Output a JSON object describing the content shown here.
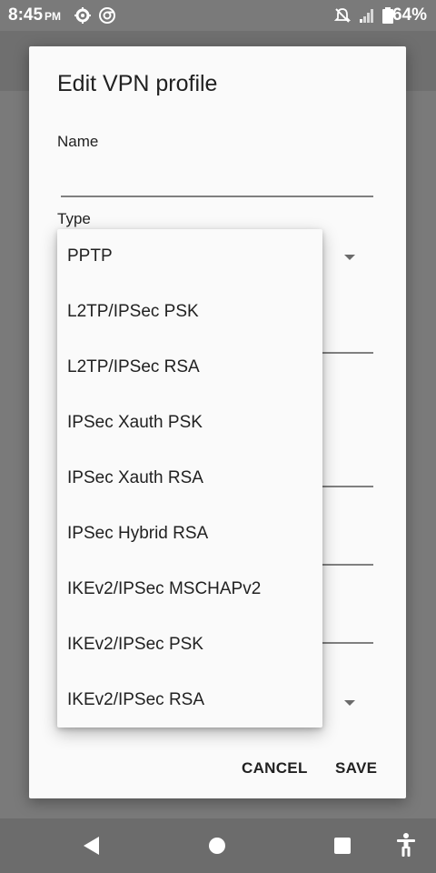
{
  "status_bar": {
    "time": "8:45",
    "ampm": "PM",
    "battery_percent": "64%"
  },
  "dialog": {
    "title": "Edit VPN profile",
    "name_label": "Name",
    "name_value": "",
    "type_label": "Type",
    "cancel_label": "CANCEL",
    "save_label": "SAVE"
  },
  "dropdown": {
    "options": [
      "PPTP",
      "L2TP/IPSec PSK",
      "L2TP/IPSec RSA",
      "IPSec Xauth PSK",
      "IPSec Xauth RSA",
      "IPSec Hybrid RSA",
      "IKEv2/IPSec MSCHAPv2",
      "IKEv2/IPSec PSK",
      "IKEv2/IPSec RSA"
    ]
  },
  "icons": {
    "settings": "gear-icon",
    "chrome": "chrome-icon",
    "notifications_off": "bell-off-icon",
    "signal": "signal-icon",
    "battery": "battery-icon",
    "back_nav": "back-icon",
    "home_nav": "home-icon",
    "recents_nav": "recents-icon",
    "accessibility": "accessibility-icon"
  }
}
